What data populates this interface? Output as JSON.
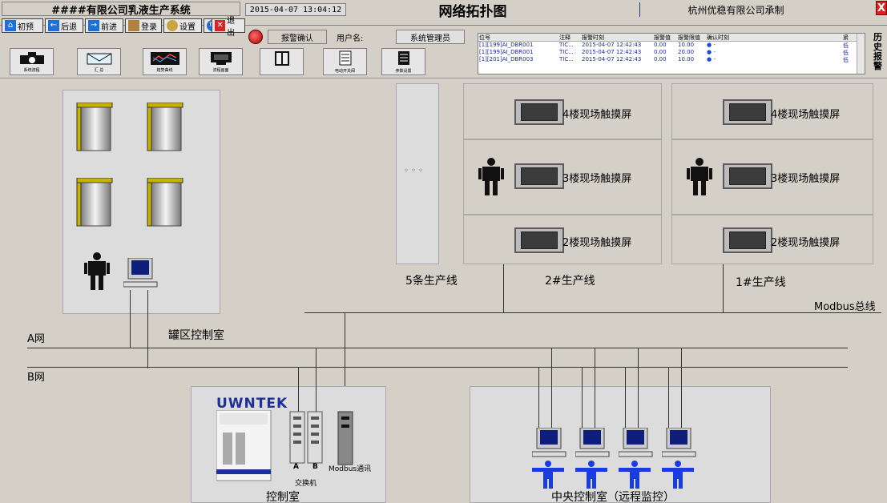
{
  "header": {
    "system_title": "####有限公司乳液生产系统",
    "datetime": "2015-04-07 13:04:12",
    "page_title": "网络拓扑图",
    "company": "杭州优稳有限公司承制",
    "close": "X"
  },
  "nav": {
    "home": "初预",
    "back": "后退",
    "forward": "前进",
    "login": "登录",
    "settings": "设置",
    "refresh": "刷新",
    "exit": "退出",
    "alarm_confirm": "报警确认",
    "username_label": "用户名:",
    "username_value": "系统管理员"
  },
  "toolbar": {
    "items": [
      "系统流程",
      "汇    总",
      "趋势曲线",
      "流程画面",
      "",
      "电动开关阀",
      "参数设置"
    ]
  },
  "alarm_list": {
    "headers": [
      "位号",
      "注释",
      "报警时刻",
      "报警值",
      "报警限值",
      "确认时刻",
      "",
      "紧"
    ],
    "rows": [
      {
        "tag": "[1][199]AI_DBR001",
        "note": "TIC...",
        "time": "2015-04-07 12:42:43",
        "value": "0.00",
        "limit": "10.00",
        "status": "低"
      },
      {
        "tag": "[1][199]AI_DBR001",
        "note": "TIC...",
        "time": "2015-04-07 12:42:43",
        "value": "0.00",
        "limit": "20.00",
        "status": "低"
      },
      {
        "tag": "[1][201]AI_DBR003",
        "note": "TIC...",
        "time": "2015-04-07 12:42:43",
        "value": "0.00",
        "limit": "10.00",
        "status": "低"
      }
    ],
    "history": "历史报警"
  },
  "topology": {
    "tank_area_label": "罐区控制室",
    "five_lines_label": "5条生产线",
    "line2_label": "2#生产线",
    "line1_label": "1#生产线",
    "modbus_bus": "Modbus总线",
    "net_a": "A网",
    "net_b": "B网",
    "touch_4f": "4楼现场触摸屏",
    "touch_3f": "3楼现场触摸屏",
    "touch_2f": "2楼现场触摸屏",
    "ellipsis": "◦ ◦ ◦",
    "control_room": "控制室",
    "switch": "交换机",
    "switch_a": "A",
    "switch_b": "B",
    "modbus_comm": "Modbus通讯",
    "central_room": "中央控制室（远程监控）",
    "brand": "UWNTEK"
  }
}
